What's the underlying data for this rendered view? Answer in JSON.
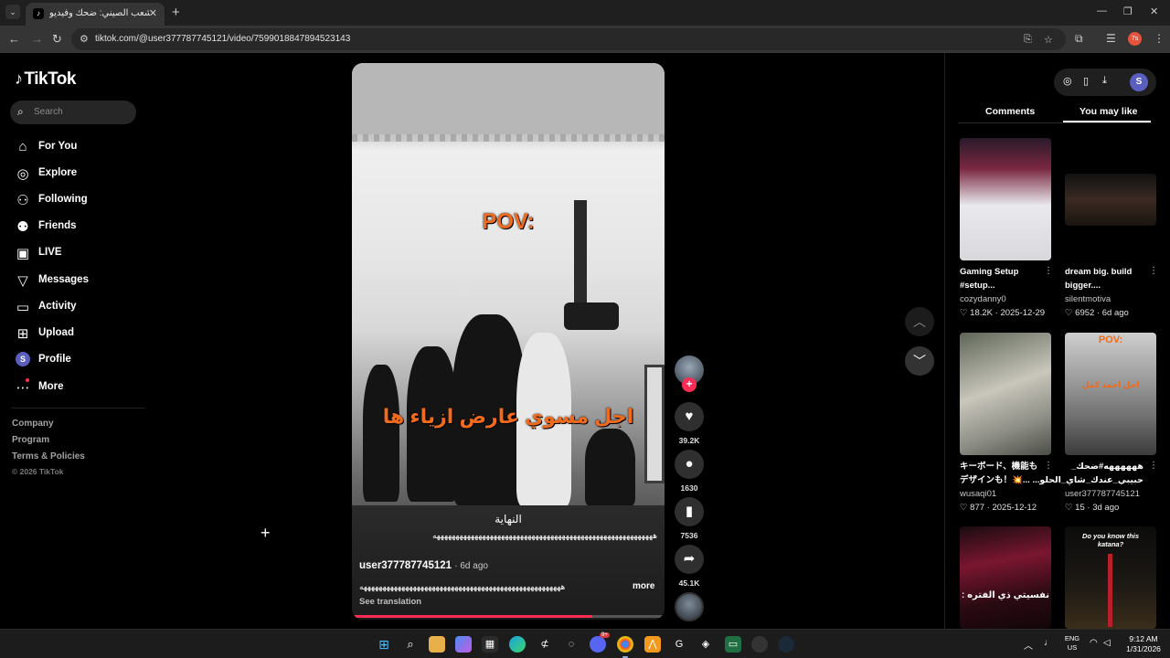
{
  "browser": {
    "tab_title": "الشعب الصيني: ضحك وفيديو",
    "tab_icon": "tiktok-icon",
    "new_tab": "+",
    "url": "tiktok.com/@user377787745121/video/7599018847894523143",
    "profile_badge": "7s"
  },
  "sidebar": {
    "logo": "TikTok",
    "search_placeholder": "Search",
    "nav": [
      {
        "label": "For You",
        "icon": "home-icon"
      },
      {
        "label": "Explore",
        "icon": "compass-icon"
      },
      {
        "label": "Following",
        "icon": "following-icon"
      },
      {
        "label": "Friends",
        "icon": "friends-icon"
      },
      {
        "label": "LIVE",
        "icon": "live-icon"
      },
      {
        "label": "Messages",
        "icon": "messages-icon"
      },
      {
        "label": "Activity",
        "icon": "activity-icon"
      },
      {
        "label": "Upload",
        "icon": "upload-icon"
      },
      {
        "label": "Profile",
        "icon": "profile-avatar",
        "avatar_letter": "S"
      },
      {
        "label": "More",
        "icon": "more-icon"
      }
    ],
    "footer": {
      "company": "Company",
      "program": "Program",
      "terms": "Terms & Policies",
      "copyright": "© 2026 TikTok"
    }
  },
  "video": {
    "overlay_top": "POV:",
    "overlay_caption": "اجل مسوي عارض ازياء ها",
    "ending_text": "النهاية",
    "squiggle": "ههههههههههههههههههههههههههههههههههههههههههههههههههههههههههه",
    "author": "user377787745121",
    "posted": "· 6d ago",
    "description": "هههههههههههههههههههههههههههههههههههههههههههههههههههههه",
    "more": "more",
    "see_translation": "See translation",
    "progress_fraction": 0.77
  },
  "actions": {
    "likes": "39.2K",
    "comments": "1630",
    "saves": "7536",
    "shares": "45.1K"
  },
  "right_panel": {
    "tabs": [
      "Comments",
      "You may like"
    ],
    "active_tab": "You may like",
    "avatar_letter": "S",
    "cards": [
      {
        "title": "Gaming Setup #setup...",
        "author": "cozydanny0",
        "likes": "18.2K",
        "date": "2025-12-29"
      },
      {
        "title": "dream big. build bigger....",
        "author": "silentmotiva",
        "likes": "6952",
        "date": "6d ago"
      },
      {
        "title": "キーボード、機能もデザインも！💥...",
        "author": "wusaqi01",
        "likes": "877",
        "date": "2025-12-12"
      },
      {
        "title": "ههههههه#ضحك_ حبيبي_عندك_شاي_الحلو...",
        "author": "user377787745121",
        "likes": "15",
        "date": "3d ago"
      },
      {
        "title": "",
        "author": "",
        "likes": "",
        "date": "",
        "thumb_text": "نفسيتي ذي الفتره :"
      },
      {
        "title": "",
        "author": "",
        "likes": "",
        "date": "",
        "thumb_text": "Do you know this katana?"
      }
    ],
    "card4_thumb_pov": "POV:",
    "card4_thumb_caption": "اجل احمد كمل"
  },
  "taskbar": {
    "lang_top": "ENG",
    "lang_bottom": "US",
    "time": "9:12 AM",
    "date": "1/31/2026",
    "discord_badge": "9+"
  }
}
